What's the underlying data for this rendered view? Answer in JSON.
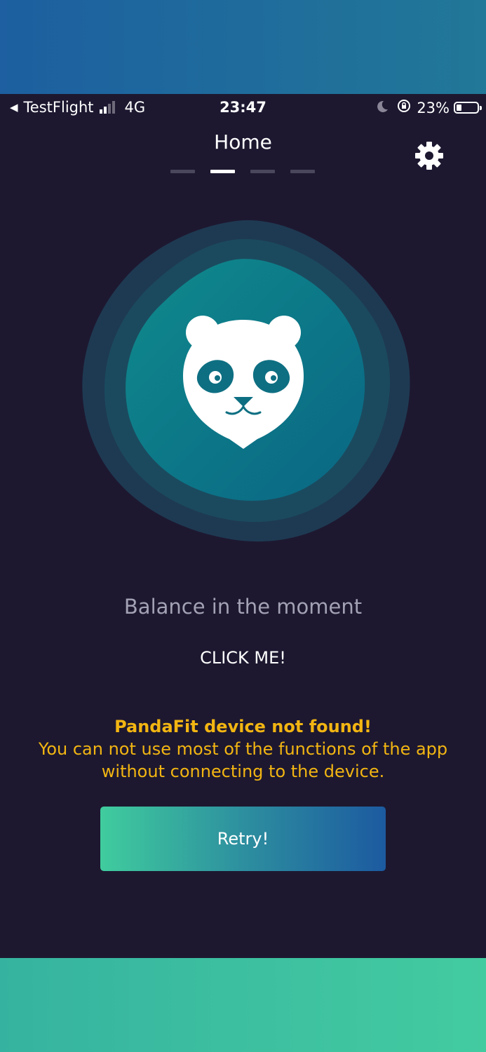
{
  "status_bar": {
    "back_app": "TestFlight",
    "network": "4G",
    "time": "23:47",
    "battery_percent": "23%",
    "battery_level": 0.23,
    "signal_bars": 2
  },
  "header": {
    "title": "Home",
    "page_count": 4,
    "active_page": 2,
    "settings_icon": "gear-icon"
  },
  "logo": {
    "icon": "panda-logo-icon",
    "colors": {
      "outer": "#1e3d55",
      "middle": "#1a4f60",
      "inner_start": "#0f7f8a",
      "inner_end": "#0a6a84"
    }
  },
  "main": {
    "tagline": "Balance in the moment",
    "click_me": "CLICK ME!"
  },
  "warning": {
    "title": "PandaFit device not found!",
    "line1": "You can not use most of the functions of the app",
    "line2": "without connecting to the device."
  },
  "retry_button": {
    "label": "Retry!"
  },
  "colors": {
    "background": "#1d1830",
    "warning": "#f2b512",
    "tagline": "#a3a1b4",
    "button_gradient_start": "#40cc9e",
    "button_gradient_end": "#1c5aa0"
  }
}
